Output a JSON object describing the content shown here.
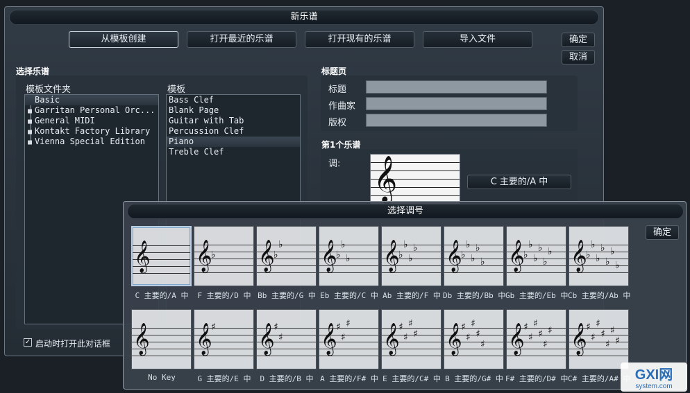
{
  "dialog": {
    "title": "新乐谱",
    "tabs": [
      "从模板创建",
      "打开最近的乐谱",
      "打开现有的乐谱",
      "导入文件"
    ],
    "ok": "确定",
    "cancel": "取消"
  },
  "select_score": {
    "label": "选择乐谱",
    "folders_label": "模板文件夹",
    "templates_label": "模板",
    "folders": [
      "Basic",
      "Garritan Personal Orc...",
      "General MIDI",
      "Kontakt Factory Library",
      "Vienna Special Edition"
    ],
    "templates": [
      "Bass Clef",
      "Blank Page",
      "Guitar with Tab",
      "Percussion Clef",
      "Piano",
      "Treble Clef"
    ]
  },
  "title_page": {
    "label": "标题页",
    "title_label": "标题",
    "composer_label": "作曲家",
    "copyright_label": "版权"
  },
  "first_staff": {
    "label": "第1个乐谱",
    "key_label": "调:",
    "key_value": "C 主要的/A 中"
  },
  "startup_checkbox": "启动时打开此对话框",
  "key_dialog": {
    "title": "选择调号",
    "ok": "确定",
    "flat_keys": [
      {
        "label": "C 主要的/A 中",
        "count": 0
      },
      {
        "label": "F 主要的/D 中",
        "count": 1
      },
      {
        "label": "Bb 主要的/G 中",
        "count": 2
      },
      {
        "label": "Eb 主要的/C 中",
        "count": 3
      },
      {
        "label": "Ab 主要的/F 中",
        "count": 4
      },
      {
        "label": "Db 主要的/Bb 中",
        "count": 5
      },
      {
        "label": "Gb 主要的/Eb 中",
        "count": 6
      },
      {
        "label": "Cb 主要的/Ab 中",
        "count": 7
      }
    ],
    "sharp_keys": [
      {
        "label": "No Key",
        "count": 0
      },
      {
        "label": "G 主要的/E 中",
        "count": 1
      },
      {
        "label": "D 主要的/B 中",
        "count": 2
      },
      {
        "label": "A 主要的/F# 中",
        "count": 3
      },
      {
        "label": "E 主要的/C# 中",
        "count": 4
      },
      {
        "label": "B 主要的/G# 中",
        "count": 5
      },
      {
        "label": "F# 主要的/D# 中",
        "count": 6
      },
      {
        "label": "C# 主要的/A# 中",
        "count": 7
      }
    ],
    "flat_symbol": "♭",
    "sharp_symbol": "♯",
    "clef_symbol": "𝄞"
  },
  "watermark": {
    "brand": "GXI网",
    "domain": "system.com"
  }
}
